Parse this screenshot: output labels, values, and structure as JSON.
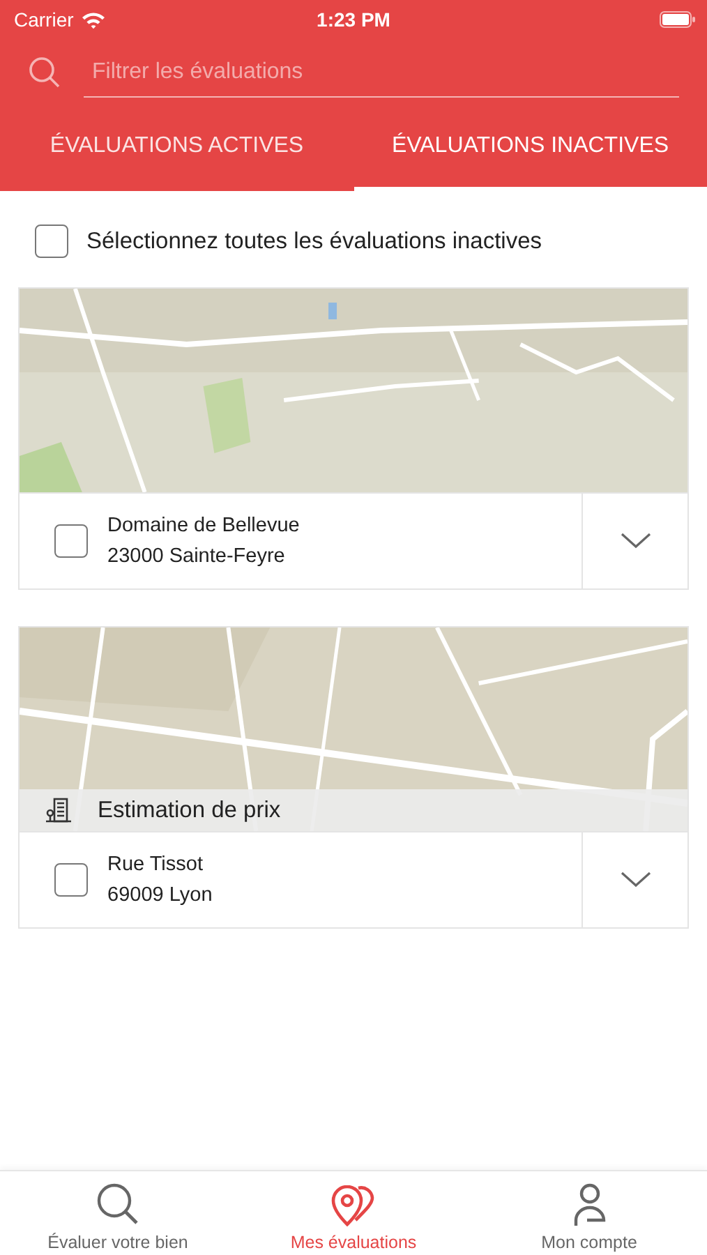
{
  "status_bar": {
    "carrier": "Carrier",
    "time": "1:23 PM"
  },
  "search": {
    "placeholder": "Filtrer les évaluations"
  },
  "tabs": [
    {
      "label": "ÉVALUATIONS ACTIVES",
      "selected": false
    },
    {
      "label": "ÉVALUATIONS INACTIVES",
      "selected": true
    }
  ],
  "select_all": {
    "label": "Sélectionnez toutes les évaluations inactives",
    "checked": false
  },
  "evaluations": [
    {
      "line_1": "Domaine de Bellevue",
      "line_2": "23000 Sainte-Feyre",
      "checked": false
    },
    {
      "line_1": "Rue Tissot",
      "line_2": "69009 Lyon",
      "checked": false,
      "tag": "Estimation de prix"
    }
  ],
  "tab_bar": [
    {
      "label": "Évaluer votre bien",
      "kind": "search",
      "selected": false
    },
    {
      "label": "Mes évaluations",
      "kind": "pins",
      "selected": true
    },
    {
      "label": "Mon compte",
      "kind": "person",
      "selected": false
    }
  ]
}
